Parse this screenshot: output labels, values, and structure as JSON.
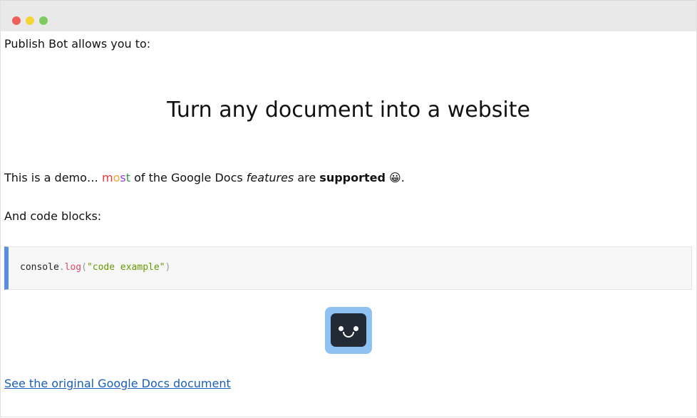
{
  "window": {
    "controls": [
      "close",
      "minimize",
      "maximize"
    ]
  },
  "content": {
    "intro": "Publish Bot allows you to:",
    "headline": "Turn any document into a website",
    "demo": {
      "lead": "This is a demo… ",
      "most_letters": [
        "m",
        "o",
        "s",
        "t"
      ],
      "mid": " of the Google Docs ",
      "features": "features",
      "are": " are ",
      "supported": "supported",
      "emoji": " 😀",
      "end": "."
    },
    "code_label": "And code blocks:",
    "code": {
      "object": "console",
      "dot": ".",
      "method": "log",
      "open": "(",
      "string": "\"code example\"",
      "close": ")"
    },
    "logo": "publish-bot-logo",
    "link_text": "See the original Google Docs document"
  },
  "colors": {
    "titlebar": "#e9e9e9",
    "code_accent": "#5b8edb",
    "link": "#1a5fb4",
    "logo_bg": "#8ec2f2",
    "logo_face": "#222a36"
  }
}
